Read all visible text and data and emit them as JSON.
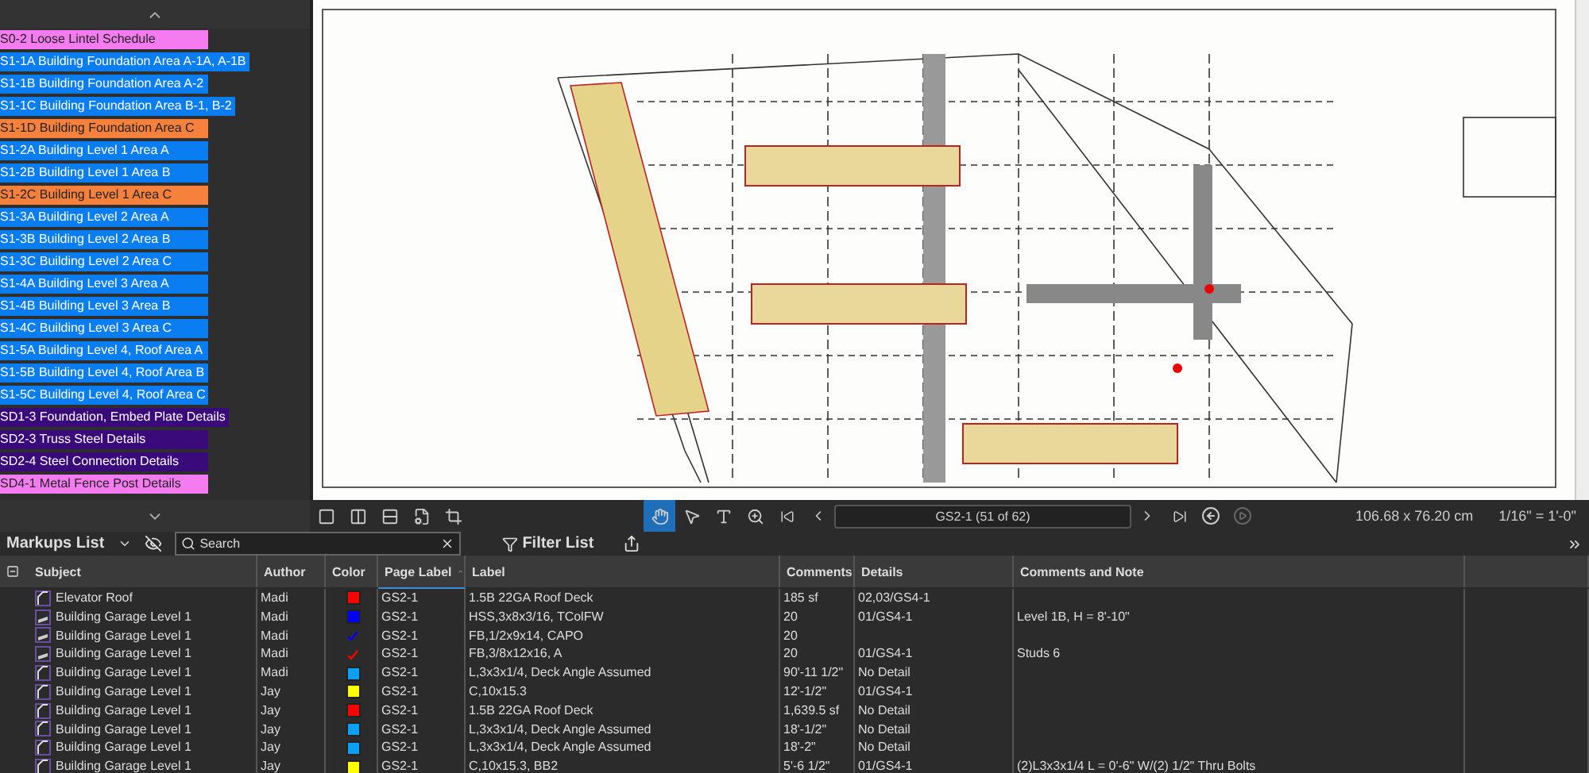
{
  "bookmarks": [
    {
      "label": "S0-2 Loose Lintel Schedule",
      "color": "#f47cf0"
    },
    {
      "label": "S1-1A Building Foundation Area A-1A, A-1B",
      "color": "#0a7ef0"
    },
    {
      "label": "S1-1B Building Foundation Area A-2",
      "color": "#0a7ef0"
    },
    {
      "label": "S1-1C Building Foundation Area B-1, B-2",
      "color": "#0a7ef0"
    },
    {
      "label": "S1-1D Building Foundation Area C",
      "color": "#f5813d"
    },
    {
      "label": "S1-2A Building Level 1 Area A",
      "color": "#0a7ef0"
    },
    {
      "label": "S1-2B Building Level 1 Area B",
      "color": "#0a7ef0"
    },
    {
      "label": "S1-2C Building Level 1 Area C",
      "color": "#f5813d"
    },
    {
      "label": "S1-3A Building Level 2 Area A",
      "color": "#0a7ef0"
    },
    {
      "label": "S1-3B Building Level 2 Area B",
      "color": "#0a7ef0"
    },
    {
      "label": "S1-3C Building Level 2 Area C",
      "color": "#0a7ef0"
    },
    {
      "label": "S1-4A Building Level 3 Area A",
      "color": "#0a7ef0"
    },
    {
      "label": "S1-4B Building Level 3 Area B",
      "color": "#0a7ef0"
    },
    {
      "label": "S1-4C Building Level 3 Area C",
      "color": "#0a7ef0"
    },
    {
      "label": "S1-5A Building Level 4, Roof Area A",
      "color": "#0a7ef0"
    },
    {
      "label": "S1-5B Building Level 4, Roof Area B",
      "color": "#0a7ef0"
    },
    {
      "label": "S1-5C Building Level 4, Roof Area C",
      "color": "#0a7ef0"
    },
    {
      "label": "SD1-3 Foundation, Embed Plate Details",
      "color": "#3a0a7a"
    },
    {
      "label": "SD2-3 Truss Steel Details",
      "color": "#3a0a7a"
    },
    {
      "label": "SD2-4 Steel Connection Details",
      "color": "#3a0a7a"
    },
    {
      "label": "SD4-1 Metal Fence Post Details",
      "color": "#f47cf0"
    }
  ],
  "toolbar": {
    "page_field": "GS2-1 (51 of 62)",
    "dimensions": "106.68 x 76.20 cm",
    "scale": "1/16\" = 1'-0\""
  },
  "markups": {
    "title": "Markups List",
    "search": {
      "placeholder": "Search"
    },
    "filter_label": "Filter List",
    "columns": [
      "Subject",
      "Author",
      "Color",
      "Page Label",
      "Label",
      "Comments",
      "Details",
      "Comments and Note"
    ],
    "rows": [
      {
        "subject": "Elevator Roof",
        "kind": "area",
        "author": "Madi",
        "swatch": {
          "kind": "square",
          "color": "#ff0000"
        },
        "page": "GS2-1",
        "label": "1.5B 22GA Roof Deck",
        "comments": "185 sf",
        "details": "02,03/GS4-1"
      },
      {
        "subject": "Building Garage Level 1",
        "kind": "count",
        "author": "Madi",
        "swatch": {
          "kind": "square",
          "color": "#0000ff"
        },
        "page": "GS2-1",
        "label": "HSS,3x8x3/16, TColFW",
        "comments": "20",
        "details": "01/GS4-1",
        "note": "Level 1B, H = 8'-10\""
      },
      {
        "subject": "Building Garage Level 1",
        "kind": "count",
        "author": "Madi",
        "swatch": {
          "kind": "check",
          "color": "#0000ff"
        },
        "page": "GS2-1",
        "label": "FB,1/2x9x14, CAPO",
        "comments": "20"
      },
      {
        "subject": "Building Garage Level 1",
        "kind": "count",
        "author": "Madi",
        "swatch": {
          "kind": "check",
          "color": "#ff0000"
        },
        "page": "GS2-1",
        "label": "FB,3/8x12x16, A",
        "comments": "20",
        "details": "01/GS4-1",
        "note": "Studs 6"
      },
      {
        "subject": "Building Garage Level 1",
        "kind": "area",
        "author": "Madi",
        "swatch": {
          "kind": "square",
          "color": "#0aa0f5"
        },
        "page": "GS2-1",
        "label": "L,3x3x1/4, Deck Angle Assumed",
        "comments": "90'-11 1/2\"",
        "details": "No Detail"
      },
      {
        "subject": "Building Garage Level 1",
        "kind": "area",
        "author": "Jay",
        "swatch": {
          "kind": "square",
          "color": "#ffff00"
        },
        "page": "GS2-1",
        "label": "C,10x15.3",
        "comments": "12'-1/2\"",
        "details": "01/GS4-1"
      },
      {
        "subject": "Building Garage Level 1",
        "kind": "area",
        "author": "Jay",
        "swatch": {
          "kind": "square",
          "color": "#ff0000"
        },
        "page": "GS2-1",
        "label": "1.5B 22GA Roof Deck",
        "comments": "1,639.5 sf",
        "details": "No Detail"
      },
      {
        "subject": "Building Garage Level 1",
        "kind": "area",
        "author": "Jay",
        "swatch": {
          "kind": "square",
          "color": "#0aa0f5"
        },
        "page": "GS2-1",
        "label": "L,3x3x1/4, Deck Angle Assumed",
        "comments": "18'-1/2\"",
        "details": "No Detail"
      },
      {
        "subject": "Building Garage Level 1",
        "kind": "area",
        "author": "Jay",
        "swatch": {
          "kind": "square",
          "color": "#0aa0f5"
        },
        "page": "GS2-1",
        "label": "L,3x3x1/4, Deck Angle Assumed",
        "comments": "18'-2\"",
        "details": "No Detail"
      },
      {
        "subject": "Building Garage Level 1",
        "kind": "area",
        "author": "Jay",
        "swatch": {
          "kind": "square",
          "color": "#ffff00"
        },
        "page": "GS2-1",
        "label": "C,10x15.3, BB2",
        "comments": "5'-6 1/2\"",
        "details": "01/GS4-1",
        "note": "(2)L3x3x1/4 L = 0'-6\" W/(2) 1/2\" Thru Bolts"
      }
    ]
  }
}
